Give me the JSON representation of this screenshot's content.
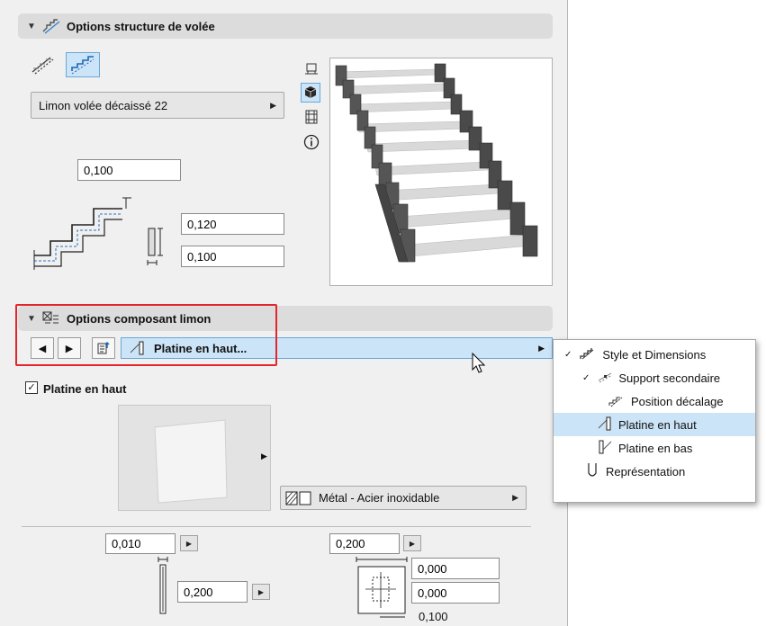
{
  "sections": {
    "flight": {
      "title": "Options structure de volée"
    },
    "component": {
      "title": "Options composant limon"
    }
  },
  "flight": {
    "stringer_dropdown": "Limon volée décaissé 22",
    "value_top": "0,100",
    "value_mid": "0,120",
    "value_bot": "0,100"
  },
  "component": {
    "selected": "Platine en haut...",
    "checkbox_label": "Platine en haut",
    "checkbox_checked": true,
    "material": "Métal - Acier inoxidable",
    "thickness": "0,010",
    "height": "0,200",
    "width": "0,200",
    "offset_1": "0,000",
    "offset_2": "0,000",
    "offset_3": "0,100"
  },
  "tree": {
    "items": [
      {
        "label": "Style et Dimensions",
        "icon": "stair-style-icon",
        "level": 0,
        "expanded": true
      },
      {
        "label": "Support secondaire",
        "icon": "support-icon",
        "level": 1,
        "expanded": true
      },
      {
        "label": "Position décalage",
        "icon": "offset-position-icon",
        "level": 2
      },
      {
        "label": "Platine en haut",
        "icon": "top-plate-icon",
        "level": 2,
        "selected": true
      },
      {
        "label": "Platine en bas",
        "icon": "bottom-plate-icon",
        "level": 2
      },
      {
        "label": "Représentation",
        "icon": "representation-icon",
        "level": 0
      }
    ]
  },
  "icons": {
    "view_modes": [
      "plan-view-icon",
      "3d-view-icon",
      "section-view-icon",
      "info-icon"
    ],
    "nav": [
      "prev-arrow-icon",
      "next-arrow-icon",
      "settings-icon"
    ]
  },
  "colors": {
    "selection": "#cce4f7",
    "highlight_box": "#e3262c",
    "header": "#dcdcdc"
  }
}
